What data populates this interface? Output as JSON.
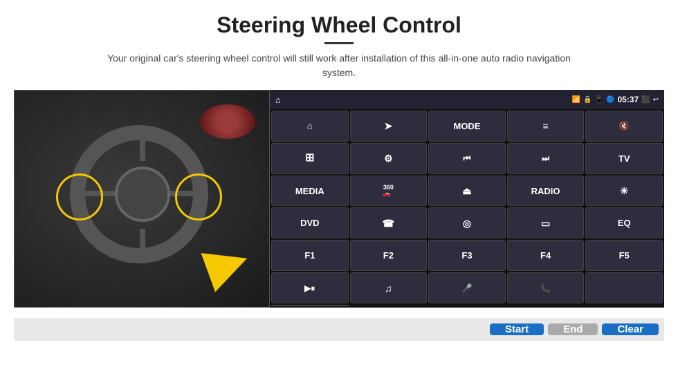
{
  "page": {
    "title": "Steering Wheel Control",
    "subtitle": "Your original car's steering wheel control will still work after installation of this all-in-one auto radio navigation system."
  },
  "statusBar": {
    "time": "05:37",
    "icons": [
      "wifi",
      "lock",
      "sim",
      "bluetooth",
      "cast",
      "back"
    ]
  },
  "gridButtons": [
    {
      "id": "home",
      "icon": "⌂",
      "label": ""
    },
    {
      "id": "nav",
      "icon": "➤",
      "label": ""
    },
    {
      "id": "mode",
      "icon": "",
      "label": "MODE"
    },
    {
      "id": "list",
      "icon": "≡",
      "label": ""
    },
    {
      "id": "mute",
      "icon": "🔇",
      "label": ""
    },
    {
      "id": "apps",
      "icon": "⊞",
      "label": ""
    },
    {
      "id": "settings",
      "icon": "⚙",
      "label": ""
    },
    {
      "id": "prev",
      "icon": "◀◀",
      "label": ""
    },
    {
      "id": "next",
      "icon": "▶▶",
      "label": ""
    },
    {
      "id": "tv",
      "icon": "",
      "label": "TV"
    },
    {
      "id": "media",
      "icon": "",
      "label": "MEDIA"
    },
    {
      "id": "360",
      "icon": "360",
      "label": ""
    },
    {
      "id": "eject",
      "icon": "⏏",
      "label": ""
    },
    {
      "id": "radio",
      "icon": "",
      "label": "RADIO"
    },
    {
      "id": "bright",
      "icon": "☀",
      "label": ""
    },
    {
      "id": "dvd",
      "icon": "",
      "label": "DVD"
    },
    {
      "id": "phone",
      "icon": "☎",
      "label": ""
    },
    {
      "id": "browser",
      "icon": "◎",
      "label": ""
    },
    {
      "id": "screen",
      "icon": "▭",
      "label": ""
    },
    {
      "id": "eq",
      "icon": "",
      "label": "EQ"
    },
    {
      "id": "f1",
      "icon": "",
      "label": "F1"
    },
    {
      "id": "f2",
      "icon": "",
      "label": "F2"
    },
    {
      "id": "f3",
      "icon": "",
      "label": "F3"
    },
    {
      "id": "f4",
      "icon": "",
      "label": "F4"
    },
    {
      "id": "f5",
      "icon": "",
      "label": "F5"
    },
    {
      "id": "playpause",
      "icon": "▶⏸",
      "label": ""
    },
    {
      "id": "music",
      "icon": "♫",
      "label": ""
    },
    {
      "id": "mic",
      "icon": "🎤",
      "label": ""
    },
    {
      "id": "call",
      "icon": "📞",
      "label": ""
    },
    {
      "id": "empty1",
      "icon": "",
      "label": ""
    },
    {
      "id": "empty2",
      "icon": "",
      "label": ""
    }
  ],
  "bottomButtons": {
    "start": "Start",
    "end": "End",
    "clear": "Clear"
  }
}
